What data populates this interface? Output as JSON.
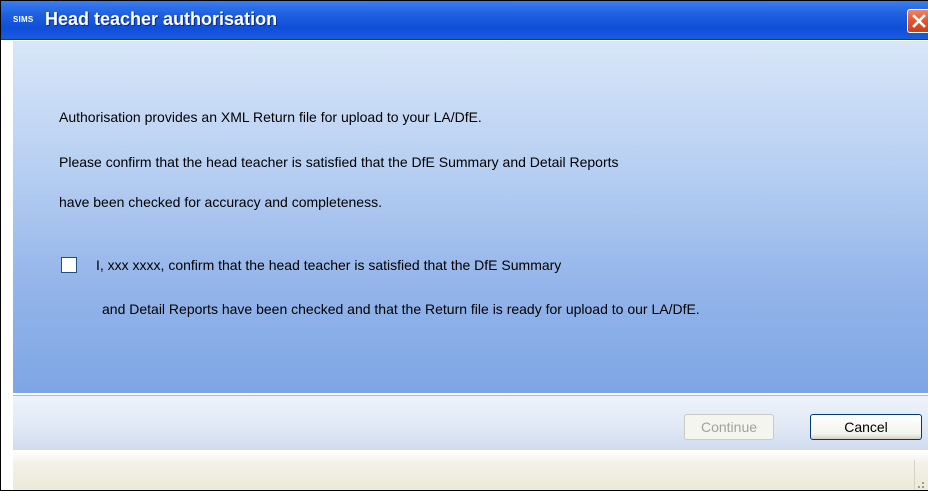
{
  "window": {
    "app_icon_text": "SIMS",
    "title": "Head teacher authorisation"
  },
  "content": {
    "line1": "Authorisation provides an XML Return file for upload to your LA/DfE.",
    "line2": "Please confirm that the head teacher is satisfied that the DfE Summary and Detail Reports",
    "line3": "have been checked for accuracy and completeness.",
    "confirm_checkbox": {
      "checked": false,
      "label_line1": "I, xxx xxxx, confirm that the head teacher is satisfied that the DfE Summary",
      "label_line2": "and Detail Reports have been checked and that the Return file is ready for upload to our LA/DfE."
    }
  },
  "buttons": {
    "continue_label": "Continue",
    "continue_enabled": false,
    "cancel_label": "Cancel"
  },
  "colors": {
    "titlebar": "#0f4fd8",
    "close_button": "#e2542c",
    "content_gradient_top": "#d8e6f8",
    "content_gradient_bottom": "#7ea6e4",
    "disabled_text": "#a3a39a"
  },
  "icons": [
    "sims-app-icon",
    "close-icon",
    "resize-grip-icon"
  ]
}
